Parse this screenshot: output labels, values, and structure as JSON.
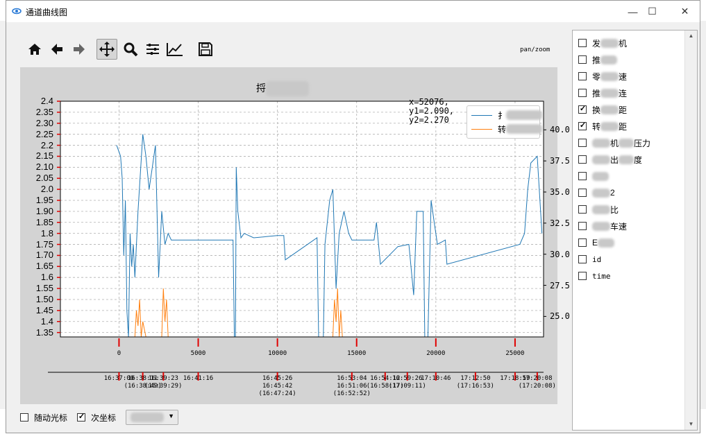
{
  "window": {
    "title": "通道曲线图",
    "minimize": "—",
    "maximize": "☐",
    "close": "✕"
  },
  "toolbar": {
    "buttons": [
      {
        "name": "home-icon",
        "glyph": "⌂"
      },
      {
        "name": "back-icon",
        "glyph": "←"
      },
      {
        "name": "forward-icon",
        "glyph": "→"
      },
      {
        "name": "pan-icon",
        "glyph": "✥"
      },
      {
        "name": "zoom-icon",
        "glyph": "⚲"
      },
      {
        "name": "subplots-icon",
        "glyph": "☰"
      },
      {
        "name": "edit-axis-icon",
        "glyph": "↗"
      },
      {
        "name": "save-icon",
        "glyph": "💾"
      }
    ],
    "mode": "pan/zoom"
  },
  "chart": {
    "title_visible": "捋",
    "readout": "x=52076,\ny1=2.090,\ny2=2.270",
    "legend": [
      {
        "label_visible": "扌",
        "color": "#1f77b4"
      },
      {
        "label_visible": "转",
        "color": "#ff7f0e"
      }
    ]
  },
  "chart_data": {
    "type": "line",
    "title": "捋",
    "x_ticks": [
      "0",
      "5000",
      "10000",
      "15000",
      "20000",
      "25000"
    ],
    "x_values": [
      0,
      5000,
      10000,
      15000,
      20000,
      25000
    ],
    "xlim": [
      -3700,
      26800
    ],
    "y_ticks": [
      "2.4",
      "2.35",
      "2.30",
      "2.25",
      "2.2",
      "2.15",
      "2.10",
      "2.05",
      "2.0",
      "1.95",
      "1.90",
      "1.85",
      "1.8",
      "1.75",
      "1.70",
      "1.65",
      "1.6",
      "1.55",
      "1.50",
      "1.45",
      "1.4",
      "1.35"
    ],
    "ylim": [
      1.33,
      2.4
    ],
    "y2_ticks": [
      "40.0",
      "37.5",
      "35.0",
      "32.5",
      "30.0",
      "27.5",
      "25.0"
    ],
    "y2_values": [
      40,
      37.5,
      35,
      32.5,
      30,
      27.5,
      25
    ],
    "y2lim": [
      23.35,
      42.3
    ],
    "grid": true,
    "legend_position": "upper right",
    "series": [
      {
        "values": [
          [
            -150,
            2.2
          ],
          [
            100,
            2.15
          ],
          [
            200,
            2.05
          ],
          [
            300,
            1.7
          ],
          [
            400,
            1.95
          ],
          [
            500,
            1.45
          ],
          [
            600,
            1.33
          ],
          [
            700,
            1.8
          ],
          [
            800,
            1.65
          ],
          [
            900,
            1.75
          ],
          [
            1000,
            1.6
          ],
          [
            1200,
            1.9
          ],
          [
            1500,
            2.25
          ],
          [
            1700,
            2.15
          ],
          [
            1900,
            2.0
          ],
          [
            2100,
            2.1
          ],
          [
            2300,
            2.2
          ],
          [
            2500,
            1.6
          ],
          [
            2700,
            1.9
          ],
          [
            2900,
            1.75
          ],
          [
            3100,
            1.8
          ],
          [
            3300,
            1.77
          ],
          [
            6500,
            1.77
          ],
          [
            7200,
            1.77
          ],
          [
            7280,
            1.33
          ],
          [
            7350,
            1.33
          ],
          [
            7400,
            2.1
          ],
          [
            7500,
            1.9
          ],
          [
            7700,
            1.78
          ],
          [
            7900,
            1.8
          ],
          [
            8500,
            1.78
          ],
          [
            10000,
            1.79
          ],
          [
            10400,
            1.79
          ],
          [
            10500,
            1.68
          ],
          [
            12500,
            1.78
          ],
          [
            12600,
            1.33
          ],
          [
            12900,
            1.33
          ],
          [
            13000,
            1.75
          ],
          [
            13300,
            1.95
          ],
          [
            13500,
            2.0
          ],
          [
            13700,
            1.55
          ],
          [
            13900,
            1.8
          ],
          [
            14200,
            1.9
          ],
          [
            14500,
            1.8
          ],
          [
            14700,
            1.77
          ],
          [
            15800,
            1.77
          ],
          [
            16100,
            1.77
          ],
          [
            16250,
            1.85
          ],
          [
            16500,
            1.66
          ],
          [
            17600,
            1.74
          ],
          [
            18300,
            1.75
          ],
          [
            18600,
            1.52
          ],
          [
            18800,
            1.9
          ],
          [
            19200,
            1.9
          ],
          [
            19300,
            1.33
          ],
          [
            19500,
            1.33
          ],
          [
            19700,
            1.95
          ],
          [
            19900,
            1.85
          ],
          [
            20100,
            1.75
          ],
          [
            20600,
            1.77
          ],
          [
            20700,
            1.66
          ],
          [
            25300,
            1.75
          ],
          [
            25600,
            1.8
          ],
          [
            25800,
            2.0
          ],
          [
            26000,
            2.12
          ],
          [
            26400,
            2.15
          ],
          [
            26700,
            1.8
          ]
        ],
        "axis": "left",
        "color": "#1f77b4"
      },
      {
        "values": [
          [
            1000,
            1.33
          ],
          [
            1100,
            1.45
          ],
          [
            1200,
            1.38
          ],
          [
            1300,
            1.5
          ],
          [
            1400,
            1.33
          ],
          [
            1500,
            1.4
          ],
          [
            1700,
            1.33
          ],
          [
            2700,
            1.33
          ],
          [
            2800,
            1.55
          ],
          [
            2900,
            1.4
          ],
          [
            3000,
            1.5
          ],
          [
            3100,
            1.33
          ],
          [
            13500,
            1.33
          ],
          [
            13600,
            1.5
          ],
          [
            13700,
            1.4
          ],
          [
            13800,
            1.55
          ],
          [
            13900,
            1.33
          ],
          [
            14000,
            1.45
          ],
          [
            14100,
            1.33
          ]
        ],
        "axis": "left",
        "color": "#ff7f0e"
      }
    ],
    "time_ticks": [
      {
        "x": 0,
        "label": "16:37:00"
      },
      {
        "x": 1500,
        "label": "16:38:11\n(16:38:49)"
      },
      {
        "x": 2800,
        "label": "16:39:23\n(16:39:29)"
      },
      {
        "x": 5000,
        "label": "16:41:16"
      },
      {
        "x": 10000,
        "label": "16:45:26\n16:45:42\n(16:47:24)"
      },
      {
        "x": 14700,
        "label": "16:53:04\n16:51:06\n(16:52:52)"
      },
      {
        "x": 16800,
        "label": "16:54:12\n(16:58:17)"
      },
      {
        "x": 18200,
        "label": "16:59:26\n(17:09:11)"
      },
      {
        "x": 20000,
        "label": "17:10:46"
      },
      {
        "x": 22500,
        "label": "17:12:50\n(17:16:53)"
      },
      {
        "x": 25000,
        "label": "17:18:59"
      },
      {
        "x": 26400,
        "label": "17:20:08\n(17:20:08)"
      }
    ]
  },
  "channels": [
    {
      "label": "发",
      "tail": "机",
      "checked": false
    },
    {
      "label": "推",
      "tail": "",
      "checked": false
    },
    {
      "label": "零",
      "tail": "速",
      "checked": false
    },
    {
      "label": "推",
      "tail": "连",
      "checked": false
    },
    {
      "label": "换",
      "tail": "距",
      "checked": true
    },
    {
      "label": "转",
      "tail": "距",
      "checked": true
    },
    {
      "label": "",
      "tail": "机",
      "tail2": "压力",
      "checked": false
    },
    {
      "label": "",
      "tail": "出",
      "tail2": "度",
      "checked": false
    },
    {
      "label": "",
      "tail": "",
      "checked": false
    },
    {
      "label": "",
      "tail": "2",
      "checked": false
    },
    {
      "label": "",
      "tail": "比",
      "checked": false
    },
    {
      "label": "",
      "tail": "车速",
      "checked": false
    },
    {
      "label": "E",
      "tail": "",
      "checked": false
    },
    {
      "label": "id",
      "tail": "",
      "checked": false
    },
    {
      "label": "time",
      "tail": "",
      "checked": false
    }
  ],
  "bottom": {
    "follow_cursor": "随动光标",
    "follow_checked": false,
    "secondary_axis": "次坐标",
    "secondary_checked": true
  }
}
